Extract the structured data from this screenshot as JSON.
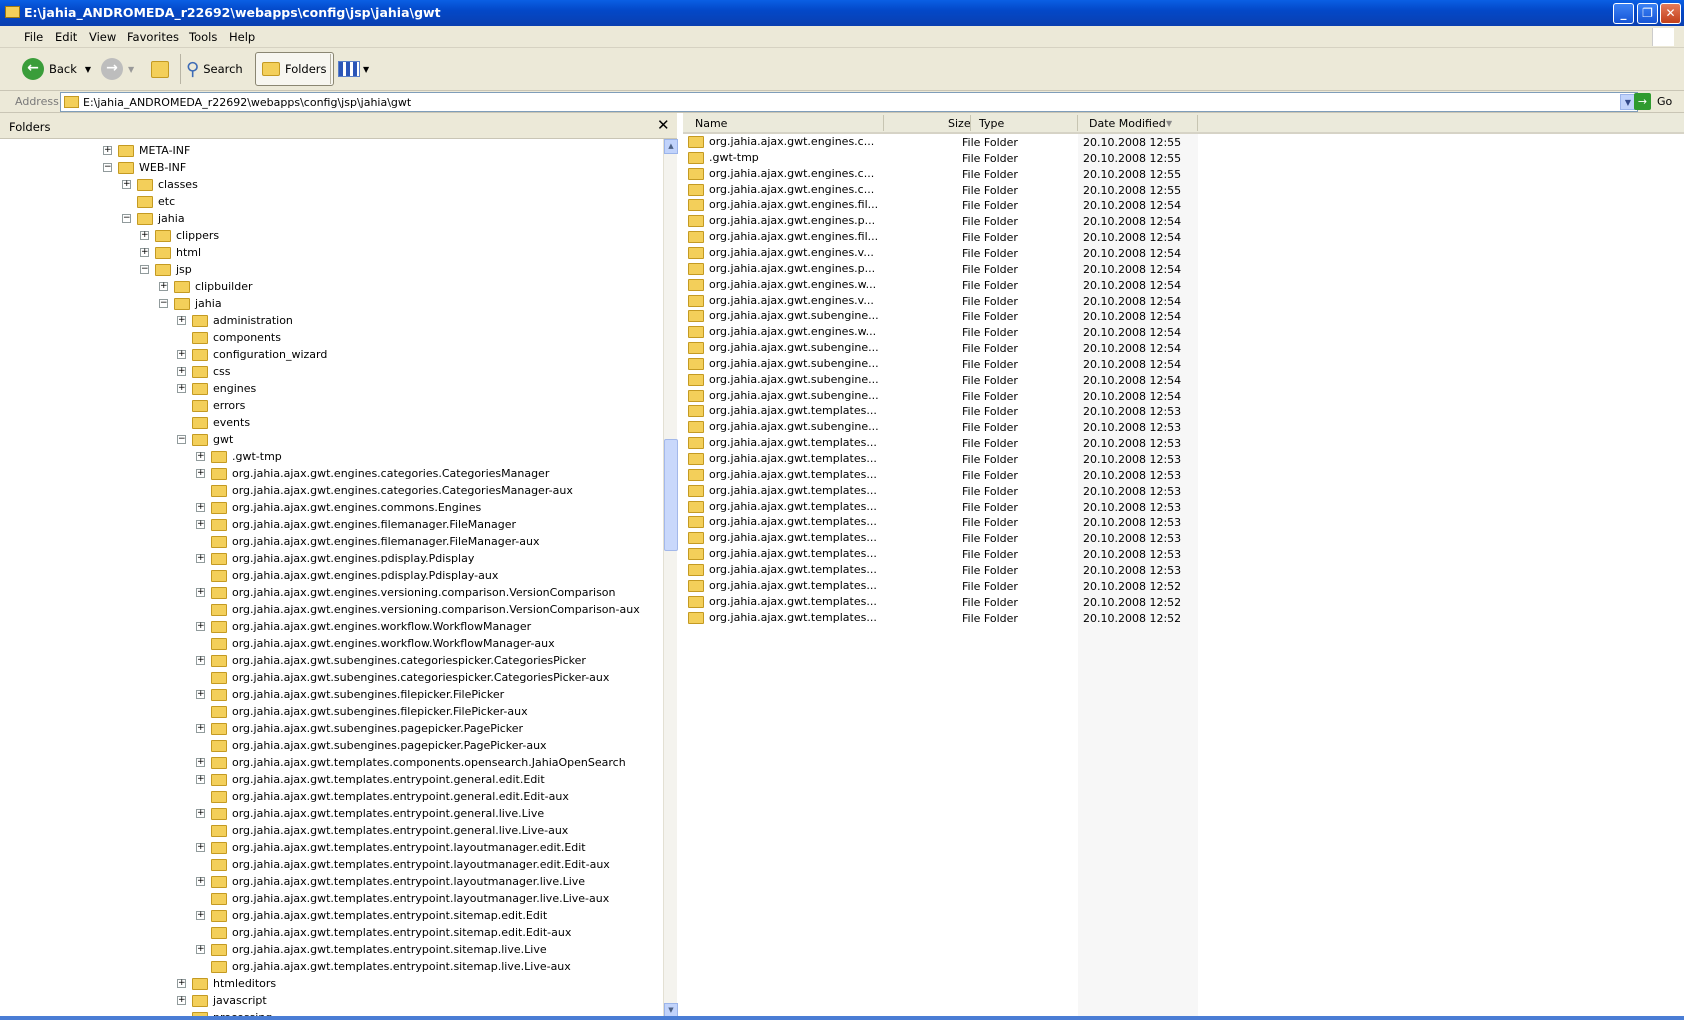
{
  "window": {
    "title": "E:\\jahia_ANDROMEDA_r22692\\webapps\\config\\jsp\\jahia\\gwt",
    "minimize": "_",
    "maximize": "❐",
    "close": "✕"
  },
  "menu": [
    "File",
    "Edit",
    "View",
    "Favorites",
    "Tools",
    "Help"
  ],
  "toolbar": {
    "back": "Back",
    "search": "Search",
    "folders": "Folders"
  },
  "address": {
    "label": "Address",
    "value": "E:\\jahia_ANDROMEDA_r22692\\webapps\\config\\jsp\\jahia\\gwt",
    "go": "Go"
  },
  "folders_pane": {
    "title": "Folders",
    "close": "✕"
  },
  "tree": [
    {
      "label": "META-INF",
      "level": 0,
      "toggle": "+"
    },
    {
      "label": "WEB-INF",
      "level": 0,
      "toggle": "-"
    },
    {
      "label": "classes",
      "level": 1,
      "toggle": "+"
    },
    {
      "label": "etc",
      "level": 1,
      "toggle": ""
    },
    {
      "label": "jahia",
      "level": 1,
      "toggle": "-"
    },
    {
      "label": "clippers",
      "level": 2,
      "toggle": "+"
    },
    {
      "label": "html",
      "level": 2,
      "toggle": "+"
    },
    {
      "label": "jsp",
      "level": 2,
      "toggle": "-"
    },
    {
      "label": "clipbuilder",
      "level": 3,
      "toggle": "+"
    },
    {
      "label": "jahia",
      "level": 3,
      "toggle": "-"
    },
    {
      "label": "administration",
      "level": 4,
      "toggle": "+"
    },
    {
      "label": "components",
      "level": 4,
      "toggle": ""
    },
    {
      "label": "configuration_wizard",
      "level": 4,
      "toggle": "+"
    },
    {
      "label": "css",
      "level": 4,
      "toggle": "+"
    },
    {
      "label": "engines",
      "level": 4,
      "toggle": "+"
    },
    {
      "label": "errors",
      "level": 4,
      "toggle": ""
    },
    {
      "label": "events",
      "level": 4,
      "toggle": ""
    },
    {
      "label": "gwt",
      "level": 4,
      "toggle": "-"
    },
    {
      "label": ".gwt-tmp",
      "level": 5,
      "toggle": "+"
    },
    {
      "label": "org.jahia.ajax.gwt.engines.categories.CategoriesManager",
      "level": 5,
      "toggle": "+"
    },
    {
      "label": "org.jahia.ajax.gwt.engines.categories.CategoriesManager-aux",
      "level": 5,
      "toggle": ""
    },
    {
      "label": "org.jahia.ajax.gwt.engines.commons.Engines",
      "level": 5,
      "toggle": "+"
    },
    {
      "label": "org.jahia.ajax.gwt.engines.filemanager.FileManager",
      "level": 5,
      "toggle": "+"
    },
    {
      "label": "org.jahia.ajax.gwt.engines.filemanager.FileManager-aux",
      "level": 5,
      "toggle": ""
    },
    {
      "label": "org.jahia.ajax.gwt.engines.pdisplay.Pdisplay",
      "level": 5,
      "toggle": "+"
    },
    {
      "label": "org.jahia.ajax.gwt.engines.pdisplay.Pdisplay-aux",
      "level": 5,
      "toggle": ""
    },
    {
      "label": "org.jahia.ajax.gwt.engines.versioning.comparison.VersionComparison",
      "level": 5,
      "toggle": "+"
    },
    {
      "label": "org.jahia.ajax.gwt.engines.versioning.comparison.VersionComparison-aux",
      "level": 5,
      "toggle": ""
    },
    {
      "label": "org.jahia.ajax.gwt.engines.workflow.WorkflowManager",
      "level": 5,
      "toggle": "+"
    },
    {
      "label": "org.jahia.ajax.gwt.engines.workflow.WorkflowManager-aux",
      "level": 5,
      "toggle": ""
    },
    {
      "label": "org.jahia.ajax.gwt.subengines.categoriespicker.CategoriesPicker",
      "level": 5,
      "toggle": "+"
    },
    {
      "label": "org.jahia.ajax.gwt.subengines.categoriespicker.CategoriesPicker-aux",
      "level": 5,
      "toggle": ""
    },
    {
      "label": "org.jahia.ajax.gwt.subengines.filepicker.FilePicker",
      "level": 5,
      "toggle": "+"
    },
    {
      "label": "org.jahia.ajax.gwt.subengines.filepicker.FilePicker-aux",
      "level": 5,
      "toggle": ""
    },
    {
      "label": "org.jahia.ajax.gwt.subengines.pagepicker.PagePicker",
      "level": 5,
      "toggle": "+"
    },
    {
      "label": "org.jahia.ajax.gwt.subengines.pagepicker.PagePicker-aux",
      "level": 5,
      "toggle": ""
    },
    {
      "label": "org.jahia.ajax.gwt.templates.components.opensearch.JahiaOpenSearch",
      "level": 5,
      "toggle": "+"
    },
    {
      "label": "org.jahia.ajax.gwt.templates.entrypoint.general.edit.Edit",
      "level": 5,
      "toggle": "+"
    },
    {
      "label": "org.jahia.ajax.gwt.templates.entrypoint.general.edit.Edit-aux",
      "level": 5,
      "toggle": ""
    },
    {
      "label": "org.jahia.ajax.gwt.templates.entrypoint.general.live.Live",
      "level": 5,
      "toggle": "+"
    },
    {
      "label": "org.jahia.ajax.gwt.templates.entrypoint.general.live.Live-aux",
      "level": 5,
      "toggle": ""
    },
    {
      "label": "org.jahia.ajax.gwt.templates.entrypoint.layoutmanager.edit.Edit",
      "level": 5,
      "toggle": "+"
    },
    {
      "label": "org.jahia.ajax.gwt.templates.entrypoint.layoutmanager.edit.Edit-aux",
      "level": 5,
      "toggle": ""
    },
    {
      "label": "org.jahia.ajax.gwt.templates.entrypoint.layoutmanager.live.Live",
      "level": 5,
      "toggle": "+"
    },
    {
      "label": "org.jahia.ajax.gwt.templates.entrypoint.layoutmanager.live.Live-aux",
      "level": 5,
      "toggle": ""
    },
    {
      "label": "org.jahia.ajax.gwt.templates.entrypoint.sitemap.edit.Edit",
      "level": 5,
      "toggle": "+"
    },
    {
      "label": "org.jahia.ajax.gwt.templates.entrypoint.sitemap.edit.Edit-aux",
      "level": 5,
      "toggle": ""
    },
    {
      "label": "org.jahia.ajax.gwt.templates.entrypoint.sitemap.live.Live",
      "level": 5,
      "toggle": "+"
    },
    {
      "label": "org.jahia.ajax.gwt.templates.entrypoint.sitemap.live.Live-aux",
      "level": 5,
      "toggle": ""
    },
    {
      "label": "htmleditors",
      "level": 4,
      "toggle": "+"
    },
    {
      "label": "javascript",
      "level": 4,
      "toggle": "+"
    },
    {
      "label": "processing",
      "level": 4,
      "toggle": ""
    }
  ],
  "list": {
    "columns": {
      "name": "Name",
      "size": "Size",
      "type": "Type",
      "date": "Date Modified"
    },
    "rows": [
      {
        "name": "org.jahia.ajax.gwt.engines.c...",
        "type": "File Folder",
        "date": "20.10.2008 12:55"
      },
      {
        "name": ".gwt-tmp",
        "type": "File Folder",
        "date": "20.10.2008 12:55"
      },
      {
        "name": "org.jahia.ajax.gwt.engines.c...",
        "type": "File Folder",
        "date": "20.10.2008 12:55"
      },
      {
        "name": "org.jahia.ajax.gwt.engines.c...",
        "type": "File Folder",
        "date": "20.10.2008 12:55"
      },
      {
        "name": "org.jahia.ajax.gwt.engines.fil...",
        "type": "File Folder",
        "date": "20.10.2008 12:54"
      },
      {
        "name": "org.jahia.ajax.gwt.engines.p...",
        "type": "File Folder",
        "date": "20.10.2008 12:54"
      },
      {
        "name": "org.jahia.ajax.gwt.engines.fil...",
        "type": "File Folder",
        "date": "20.10.2008 12:54"
      },
      {
        "name": "org.jahia.ajax.gwt.engines.v...",
        "type": "File Folder",
        "date": "20.10.2008 12:54"
      },
      {
        "name": "org.jahia.ajax.gwt.engines.p...",
        "type": "File Folder",
        "date": "20.10.2008 12:54"
      },
      {
        "name": "org.jahia.ajax.gwt.engines.w...",
        "type": "File Folder",
        "date": "20.10.2008 12:54"
      },
      {
        "name": "org.jahia.ajax.gwt.engines.v...",
        "type": "File Folder",
        "date": "20.10.2008 12:54"
      },
      {
        "name": "org.jahia.ajax.gwt.subengine...",
        "type": "File Folder",
        "date": "20.10.2008 12:54"
      },
      {
        "name": "org.jahia.ajax.gwt.engines.w...",
        "type": "File Folder",
        "date": "20.10.2008 12:54"
      },
      {
        "name": "org.jahia.ajax.gwt.subengine...",
        "type": "File Folder",
        "date": "20.10.2008 12:54"
      },
      {
        "name": "org.jahia.ajax.gwt.subengine...",
        "type": "File Folder",
        "date": "20.10.2008 12:54"
      },
      {
        "name": "org.jahia.ajax.gwt.subengine...",
        "type": "File Folder",
        "date": "20.10.2008 12:54"
      },
      {
        "name": "org.jahia.ajax.gwt.subengine...",
        "type": "File Folder",
        "date": "20.10.2008 12:54"
      },
      {
        "name": "org.jahia.ajax.gwt.templates...",
        "type": "File Folder",
        "date": "20.10.2008 12:53"
      },
      {
        "name": "org.jahia.ajax.gwt.subengine...",
        "type": "File Folder",
        "date": "20.10.2008 12:53"
      },
      {
        "name": "org.jahia.ajax.gwt.templates...",
        "type": "File Folder",
        "date": "20.10.2008 12:53"
      },
      {
        "name": "org.jahia.ajax.gwt.templates...",
        "type": "File Folder",
        "date": "20.10.2008 12:53"
      },
      {
        "name": "org.jahia.ajax.gwt.templates...",
        "type": "File Folder",
        "date": "20.10.2008 12:53"
      },
      {
        "name": "org.jahia.ajax.gwt.templates...",
        "type": "File Folder",
        "date": "20.10.2008 12:53"
      },
      {
        "name": "org.jahia.ajax.gwt.templates...",
        "type": "File Folder",
        "date": "20.10.2008 12:53"
      },
      {
        "name": "org.jahia.ajax.gwt.templates...",
        "type": "File Folder",
        "date": "20.10.2008 12:53"
      },
      {
        "name": "org.jahia.ajax.gwt.templates...",
        "type": "File Folder",
        "date": "20.10.2008 12:53"
      },
      {
        "name": "org.jahia.ajax.gwt.templates...",
        "type": "File Folder",
        "date": "20.10.2008 12:53"
      },
      {
        "name": "org.jahia.ajax.gwt.templates...",
        "type": "File Folder",
        "date": "20.10.2008 12:53"
      },
      {
        "name": "org.jahia.ajax.gwt.templates...",
        "type": "File Folder",
        "date": "20.10.2008 12:52"
      },
      {
        "name": "org.jahia.ajax.gwt.templates...",
        "type": "File Folder",
        "date": "20.10.2008 12:52"
      },
      {
        "name": "org.jahia.ajax.gwt.templates...",
        "type": "File Folder",
        "date": "20.10.2008 12:52"
      }
    ]
  }
}
